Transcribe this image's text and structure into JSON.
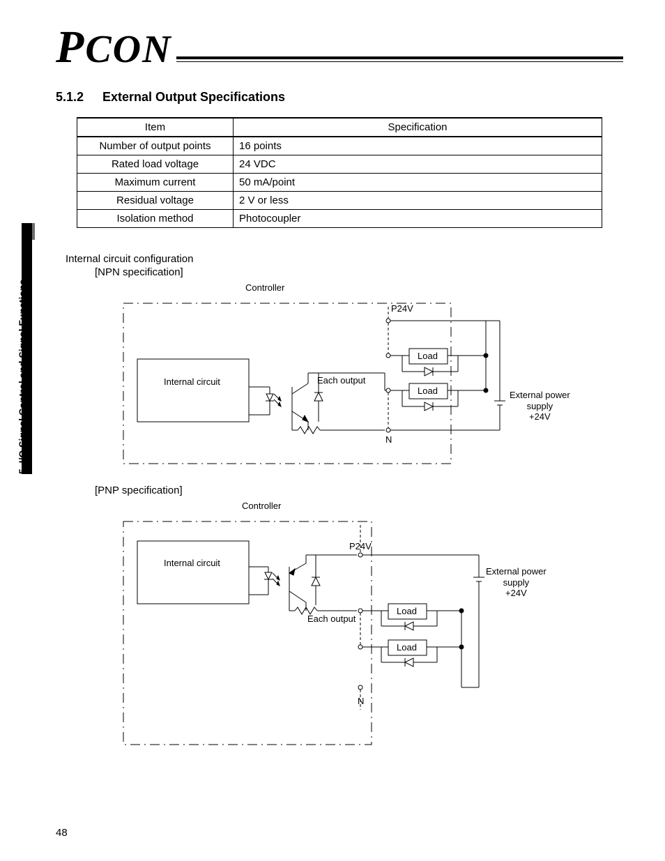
{
  "logo": "PCON",
  "section": {
    "number": "5.1.2",
    "title": "External Output Specifications"
  },
  "table": {
    "headers": [
      "Item",
      "Specification"
    ],
    "rows": [
      {
        "item": "Number of output points",
        "spec": "16 points"
      },
      {
        "item": "Rated load voltage",
        "spec": "24 VDC"
      },
      {
        "item": "Maximum current",
        "spec": "50 mA/point"
      },
      {
        "item": "Residual voltage",
        "spec": "2 V or less"
      },
      {
        "item": "Isolation method",
        "spec": "Photocoupler"
      }
    ]
  },
  "config_heading": "Internal circuit configuration",
  "npn_label": "[NPN specification]",
  "pnp_label": "[PNP specification]",
  "diagram_labels": {
    "controller": "Controller",
    "internal_circuit": "Internal circuit",
    "each_output": "Each output",
    "p24v": "P24V",
    "n": "N",
    "load": "Load",
    "ext_power": "External power\nsupply\n+24V"
  },
  "sidebar_text": "5. I/O Signal Control and Signal Functions",
  "page_number": "48"
}
